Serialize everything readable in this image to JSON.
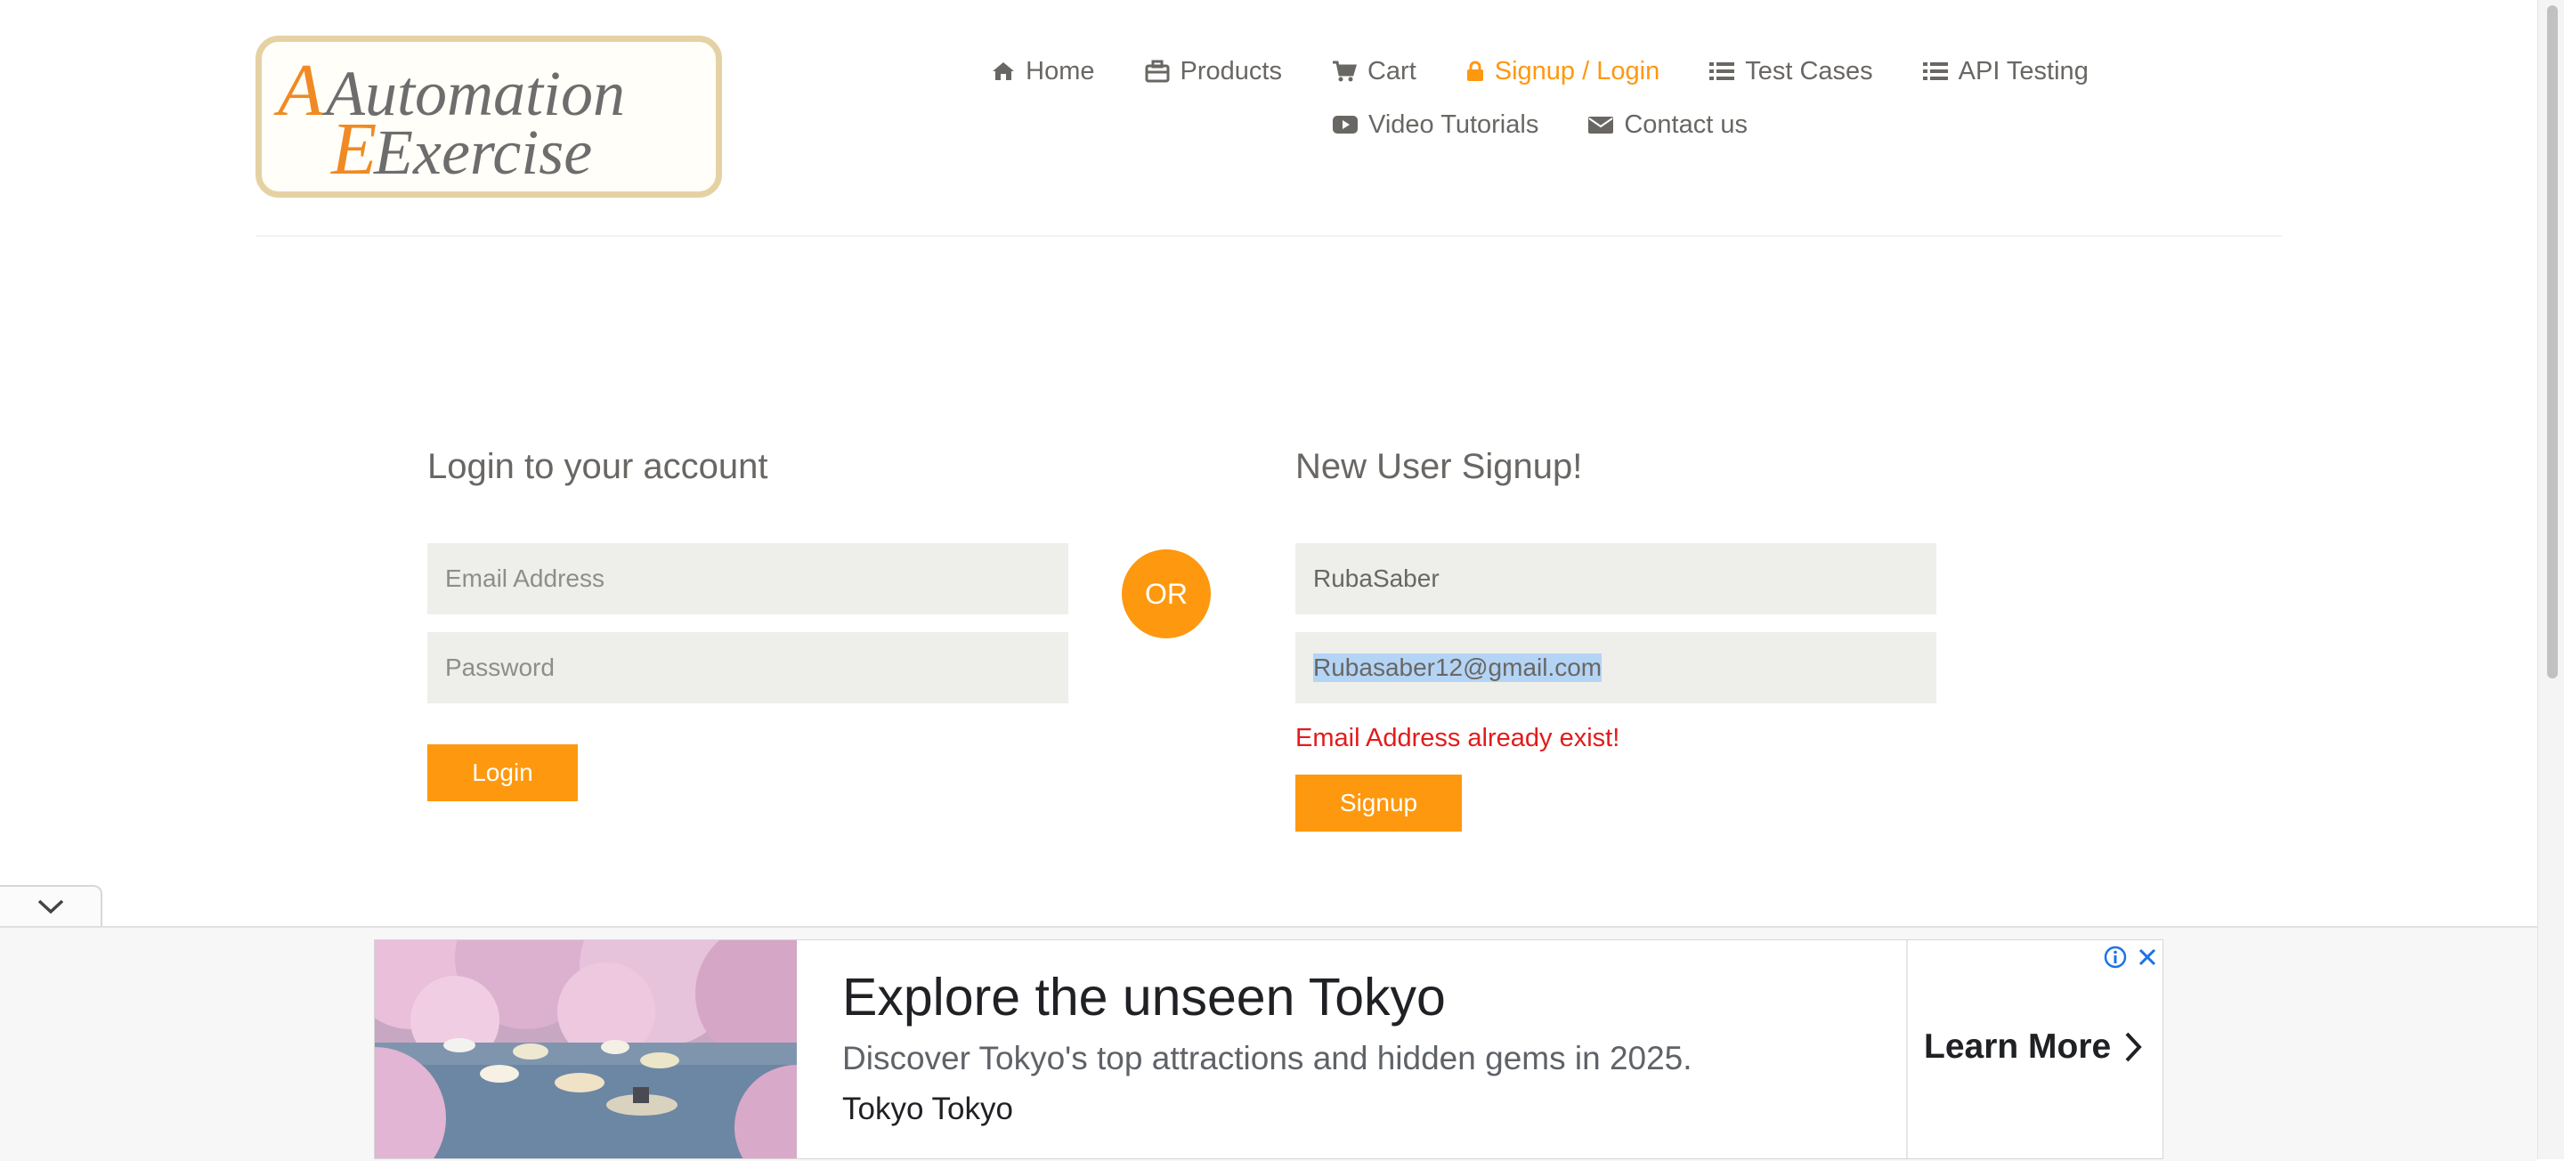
{
  "brand": {
    "logo_line1": "Automation",
    "logo_line2": "Exercise"
  },
  "nav": {
    "items": [
      {
        "label": "Home",
        "icon": "home-icon"
      },
      {
        "label": "Products",
        "icon": "briefcase-icon"
      },
      {
        "label": "Cart",
        "icon": "cart-icon"
      },
      {
        "label": "Signup / Login",
        "icon": "lock-icon",
        "active": true
      },
      {
        "label": "Test Cases",
        "icon": "list-icon"
      },
      {
        "label": "API Testing",
        "icon": "list-icon"
      },
      {
        "label": "Video Tutorials",
        "icon": "youtube-play-icon"
      },
      {
        "label": "Contact us",
        "icon": "envelope-icon"
      }
    ]
  },
  "login": {
    "title": "Login to your account",
    "email_placeholder": "Email Address",
    "password_placeholder": "Password",
    "button": "Login"
  },
  "divider_label": "OR",
  "signup": {
    "title": "New User Signup!",
    "name_value": "RubaSaber",
    "email_value": "Rubasaber12@gmail.com",
    "error": "Email Address already exist!",
    "button": "Signup"
  },
  "ad": {
    "headline": "Explore the unseen Tokyo",
    "description": "Discover Tokyo's top attractions and hidden gems in 2025.",
    "advertiser": "Tokyo Tokyo",
    "cta": "Learn More"
  },
  "colors": {
    "accent": "#fe980f",
    "text": "#696763",
    "field_bg": "#eeeeea",
    "error": "#e31b1b"
  }
}
